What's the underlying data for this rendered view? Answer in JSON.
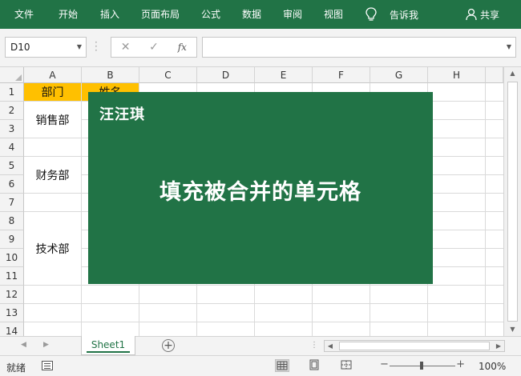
{
  "ribbon": {
    "tabs": [
      "文件",
      "开始",
      "插入",
      "页面布局",
      "公式",
      "数据",
      "审阅",
      "视图"
    ],
    "tell_me": "告诉我",
    "share": "共享"
  },
  "formula_bar": {
    "name_box": "D10",
    "fx_label": "fx",
    "formula": ""
  },
  "sheet": {
    "columns": [
      "A",
      "B",
      "C",
      "D",
      "E",
      "F",
      "G",
      "H"
    ],
    "rows": [
      "1",
      "2",
      "3",
      "4",
      "5",
      "6",
      "7",
      "8",
      "9",
      "10",
      "11",
      "12",
      "13",
      "14"
    ],
    "header_a1": "部门",
    "header_b1": "姓名",
    "groups": [
      "销售部",
      "财务部",
      "技术部"
    ],
    "header_fill": "#ffc000"
  },
  "overlay": {
    "brand": "汪汪琪",
    "headline": "填充被合并的单元格",
    "background": "#217346"
  },
  "tabs_bar": {
    "sheet_name": "Sheet1",
    "add_symbol": "⊕"
  },
  "status_bar": {
    "ready": "就绪",
    "zoom": "100%"
  },
  "accent_color": "#217346"
}
